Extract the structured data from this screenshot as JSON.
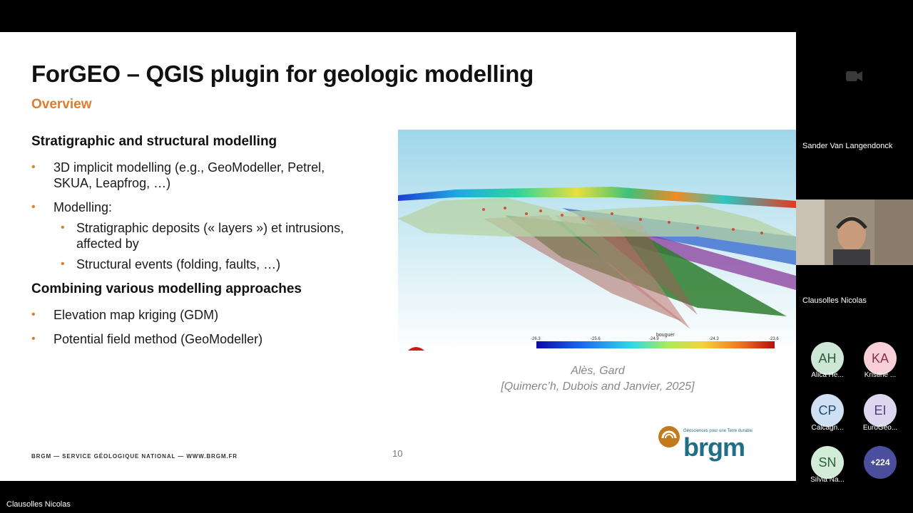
{
  "slide": {
    "title": "ForGEO – QGIS plugin for geologic modelling",
    "subtitle": "Overview",
    "section1_heading": "Stratigraphic and structural modelling",
    "bullet1_line1": "3D implicit modelling (e.g.,  GeoModeller, Petrel,",
    "bullet1_line2": "SKUA, Leapfrog, …)",
    "bullet2": "Modelling:",
    "bullet2a_line1": "Stratigraphic deposits (« layers ») et intrusions,",
    "bullet2a_line2": "affected by",
    "bullet2b": "Structural events (folding, faults, …)",
    "section2_heading": "Combining various modelling approaches",
    "bullet3": "Elevation map kriging (GDM)",
    "bullet4": "Potential field method (GeoModeller)",
    "caption_line1": "Alès, Gard",
    "caption_line2": "[Quimerc’h, Dubois and Janvier, 2025]",
    "footer": "BRGM — SERVICE GÉOLOGIQUE NATIONAL — WWW.BRGM.FR",
    "page_number": "10",
    "logo_text": "brgm",
    "logo_tagline": "Géosciences pour une Terre durable",
    "colorbar": {
      "label": "bouguer",
      "ticks": [
        "-26.3",
        "-25.6",
        "-24.9",
        "-24.3",
        "-23.6"
      ]
    }
  },
  "side_panel": {
    "top_participant": "Sander Van Langendonck",
    "video_participant": "Clausolles  Nicolas",
    "avatars": [
      {
        "initials": "AH",
        "name": "Alica He...",
        "bg": "#cde6d6",
        "fg": "#2b5a3d"
      },
      {
        "initials": "KA",
        "name": "Kristine ...",
        "bg": "#f6cfd8",
        "fg": "#8a2f48"
      },
      {
        "initials": "CP",
        "name": "Calcagn...",
        "bg": "#cfe0f2",
        "fg": "#244b74"
      },
      {
        "initials": "EI",
        "name": "EuroGeo...",
        "bg": "#dcd7ee",
        "fg": "#4a3f7a"
      },
      {
        "initials": "SN",
        "name": "Silvia Na...",
        "bg": "#d3ecd8",
        "fg": "#2d5e3a"
      }
    ],
    "more_count": "+224",
    "more_bg": "#4b4e9c"
  },
  "presenter_name": "Clausolles  Nicolas"
}
